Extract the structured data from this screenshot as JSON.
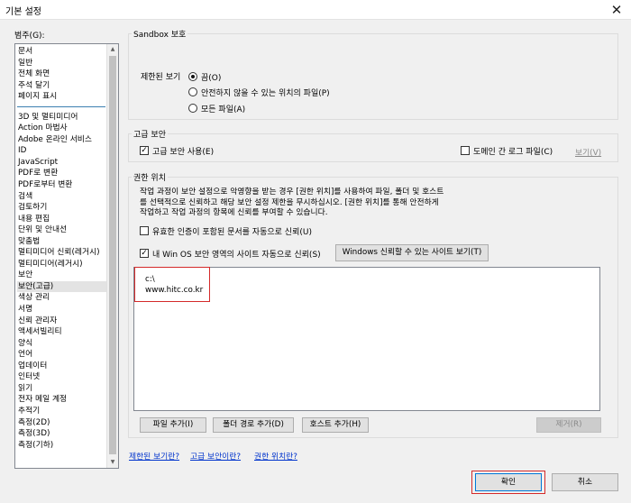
{
  "window": {
    "title": "기본 설정",
    "close_glyph": "✕"
  },
  "categories": {
    "label": "범주(G):",
    "group1": [
      "문서",
      "일반",
      "전체 화면",
      "주석 달기",
      "페이지 표시"
    ],
    "group2": [
      "3D 및 멀티미디어",
      "Action 마법사",
      "Adobe 온라인 서비스",
      "ID",
      "JavaScript",
      "PDF로 변환",
      "PDF로부터 변환",
      "검색",
      "검토하기",
      "내용 편집",
      "단위 및 안내선",
      "맞춤법",
      "멀티미디어 신뢰(레거시)",
      "멀티미디어(레거시)",
      "보안",
      "보안(고급)",
      "색상 관리",
      "서명",
      "신뢰 관리자",
      "액세서빌리티",
      "양식",
      "언어",
      "업데이터",
      "인터넷",
      "읽기",
      "전자 메일 계정",
      "추적기",
      "측정(2D)",
      "측정(3D)",
      "측정(기하)"
    ],
    "selected": "보안(고급)"
  },
  "sandbox": {
    "title": "Sandbox 보호",
    "label": "제한된 보기",
    "options": [
      "끔(O)",
      "안전하지 않을 수 있는 위치의 파일(P)",
      "모든 파일(A)"
    ],
    "selected_index": 0
  },
  "enhanced": {
    "title": "고급 보안",
    "enable_label": "고급 보안 사용(E)",
    "enable_checked": true,
    "cross_domain_label": "도메인 간 로그 파일(C)",
    "cross_domain_checked": false,
    "view_link": "보기(V)"
  },
  "privileged": {
    "title": "권한 위치",
    "description_lines": [
      "작업 과정이 보안 설정으로 악영향을 받는 경우 [권한 위치]를 사용하여 파일, 폴더 및 호스트",
      "를 선택적으로 신뢰하고 해당 보안 설정 제한을 무시하십시오. [권한 위치]를 통해 안전하게",
      "작업하고 작업 과정의 항목에 신뢰를 부여할 수 있습니다."
    ],
    "cert_label": "유효한 인증이 포함된 문서를 자동으로 신뢰(U)",
    "cert_checked": false,
    "win_os_label": "내 Win OS 보안 영역의 사이트 자동으로 신뢰(S)",
    "win_os_checked": true,
    "windows_sites_button": "Windows 신뢰할 수 있는 사이트 보기(T)",
    "locations": [
      "c:\\",
      "www.hitc.co.kr"
    ],
    "add_file_button": "파일 추가(I)",
    "add_folder_button": "폴더 경로 추가(D)",
    "add_host_button": "호스트 추가(H)",
    "remove_button": "제거(R)"
  },
  "links": {
    "protected_view": "제한된 보기란?",
    "enhanced_security": "고급 보안이란?",
    "privileged_locations": "권한 위치란?"
  },
  "footer": {
    "ok_button": "확인",
    "cancel_button": "취소"
  },
  "icons": {
    "check": "✓",
    "scroll_up": "▲",
    "scroll_down": "▼"
  },
  "colors": {
    "highlight_red": "#d42a2a",
    "link_blue": "#0033cc",
    "accent_separator": "#3c7fb1"
  }
}
